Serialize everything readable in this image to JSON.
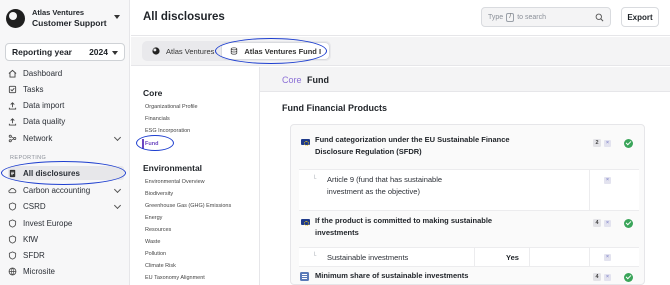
{
  "org": {
    "name": "Atlas Ventures",
    "subtitle": "Customer Support"
  },
  "reporting": {
    "label": "Reporting year",
    "year": "2024"
  },
  "sidebar": {
    "section_label": "REPORTING",
    "items": [
      {
        "label": "Dashboard",
        "icon": "home-icon"
      },
      {
        "label": "Tasks",
        "icon": "tasks-icon"
      },
      {
        "label": "Data import",
        "icon": "upload-icon"
      },
      {
        "label": "Data quality",
        "icon": "upload-icon"
      },
      {
        "label": "Network",
        "icon": "network-icon"
      },
      {
        "label": "All disclosures",
        "icon": "document-icon"
      },
      {
        "label": "Carbon accounting",
        "icon": "cloud-icon"
      },
      {
        "label": "CSRD",
        "icon": "badge-icon"
      },
      {
        "label": "Invest Europe",
        "icon": "badge-icon"
      },
      {
        "label": "KfW",
        "icon": "badge-icon"
      },
      {
        "label": "SFDR",
        "icon": "badge-icon"
      },
      {
        "label": "Microsite",
        "icon": "globe-icon"
      }
    ]
  },
  "header": {
    "title": "All disclosures",
    "search_before": "Type",
    "search_key": "/",
    "search_after": "to search",
    "export_label": "Export"
  },
  "entity_tabs": [
    {
      "label": "Atlas Ventures",
      "icon": "logo-icon"
    },
    {
      "label": "Atlas Ventures Fund I",
      "icon": "database-icon"
    }
  ],
  "topics": {
    "core_title": "Core",
    "core_items": [
      "Organizational Profile",
      "Financials",
      "ESG Incorporation",
      "Fund"
    ],
    "env_title": "Environmental",
    "env_items": [
      "Environmental Overview",
      "Biodiversity",
      "Greenhouse Gas (GHG) Emissions",
      "Energy",
      "Resources",
      "Waste",
      "Pollution",
      "Climate Risk",
      "EU Taxonomy Alignment"
    ]
  },
  "breadcrumb": {
    "section": "Core",
    "topic": "Fund"
  },
  "content": {
    "section_title": "Fund Financial Products",
    "questions": [
      {
        "text": "Fund categorization under the EU Sustainable Finance Disclosure Regulation (SFDR)",
        "count": "2",
        "x": "×",
        "sub": {
          "text": "Article 9 (fund that has sustainable investment as the objective)",
          "x": "×"
        }
      },
      {
        "text": "If the product is committed to making sustainable investments",
        "count": "4",
        "x": "×",
        "sub": {
          "text": "Sustainable investments",
          "value": "Yes",
          "x": "×"
        }
      },
      {
        "text": "Minimum share of sustainable investments",
        "count": "4",
        "x": "×"
      }
    ]
  },
  "colors": {
    "accent": "#6b46c1",
    "highlight": "#1d3ecf",
    "success": "#3aa55a"
  }
}
